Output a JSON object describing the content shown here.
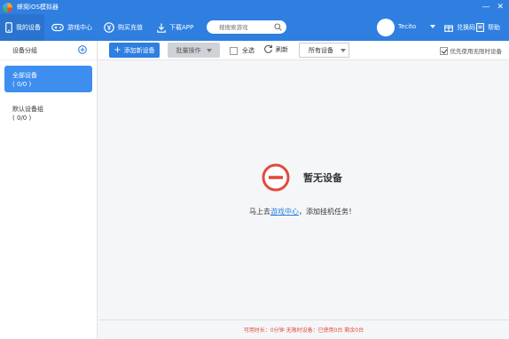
{
  "window": {
    "title": "蜂窝iOS模拟器",
    "controls": {
      "minimize": "—",
      "close": "✕"
    }
  },
  "nav": {
    "items": [
      {
        "label": "我的设备",
        "icon": "phone-icon"
      },
      {
        "label": "游戏中心",
        "icon": "gamepad-icon"
      },
      {
        "label": "购买充值",
        "icon": "coin-icon"
      },
      {
        "label": "下载APP",
        "icon": "download-icon"
      }
    ],
    "search": {
      "placeholder": "搜搜索游戏"
    },
    "user": {
      "name": "Tecito"
    },
    "exchange_label": "兑换码",
    "help_label": "帮助"
  },
  "sidebar": {
    "header": "设备分组",
    "groups": [
      {
        "name": "全部设备",
        "count": "( 0/0 )"
      },
      {
        "name": "默认设备组",
        "count": "( 0/0 )"
      }
    ]
  },
  "toolbar": {
    "add_label": "添加新设备",
    "batch_label": "批量操作",
    "select_all_label": "全选",
    "refresh_label": "刷新",
    "all_devices_label": "所有设备",
    "priority_label": "优先使用无限时设备",
    "priority_checked": true
  },
  "main": {
    "empty_title": "暂无设备",
    "hint_prefix": "马上去",
    "hint_link": "游戏中心",
    "hint_suffix": "，添加挂机任务！"
  },
  "footer": {
    "text": "可用时长：0分钟  无限时设备：已使用0台 剩余0台"
  },
  "colors": {
    "accent": "#2e7fe0",
    "warning": "#e14b3b"
  }
}
